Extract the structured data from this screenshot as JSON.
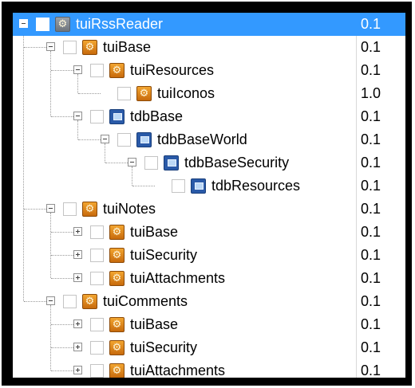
{
  "tree": {
    "rows": [
      {
        "name": "tuiRssReader",
        "version": "0.1",
        "icon": "gear-icon",
        "toggle": "collapse"
      },
      {
        "name": "tuiBase",
        "version": "0.1",
        "icon": "gear-icon",
        "toggle": "collapse"
      },
      {
        "name": "tuiResources",
        "version": "0.1",
        "icon": "gear-icon",
        "toggle": "collapse"
      },
      {
        "name": "tuiIconos",
        "version": "1.0",
        "icon": "gear-icon",
        "toggle": "none"
      },
      {
        "name": "tdbBase",
        "version": "0.1",
        "icon": "folder-icon",
        "toggle": "collapse"
      },
      {
        "name": "tdbBaseWorld",
        "version": "0.1",
        "icon": "folder-icon",
        "toggle": "collapse"
      },
      {
        "name": "tdbBaseSecurity",
        "version": "0.1",
        "icon": "folder-icon",
        "toggle": "collapse"
      },
      {
        "name": "tdbResources",
        "version": "0.1",
        "icon": "folder-icon",
        "toggle": "none"
      },
      {
        "name": "tuiNotes",
        "version": "0.1",
        "icon": "gear-icon",
        "toggle": "collapse"
      },
      {
        "name": "tuiBase",
        "version": "0.1",
        "icon": "gear-icon",
        "toggle": "expand"
      },
      {
        "name": "tuiSecurity",
        "version": "0.1",
        "icon": "gear-icon",
        "toggle": "expand"
      },
      {
        "name": "tuiAttachments",
        "version": "0.1",
        "icon": "gear-icon",
        "toggle": "expand"
      },
      {
        "name": "tuiComments",
        "version": "0.1",
        "icon": "gear-icon",
        "toggle": "collapse"
      },
      {
        "name": "tuiBase",
        "version": "0.1",
        "icon": "gear-icon",
        "toggle": "expand"
      },
      {
        "name": "tuiSecurity",
        "version": "0.1",
        "icon": "gear-icon",
        "toggle": "expand"
      },
      {
        "name": "tuiAttachments",
        "version": "0.1",
        "icon": "gear-icon",
        "toggle": "expand"
      }
    ],
    "selected_row": "tuiRssReader"
  },
  "colors": {
    "selection": "#3399ff",
    "frame": "#000000",
    "gear_icon": "#e08a1e",
    "folder_icon": "#2a5aa8"
  }
}
